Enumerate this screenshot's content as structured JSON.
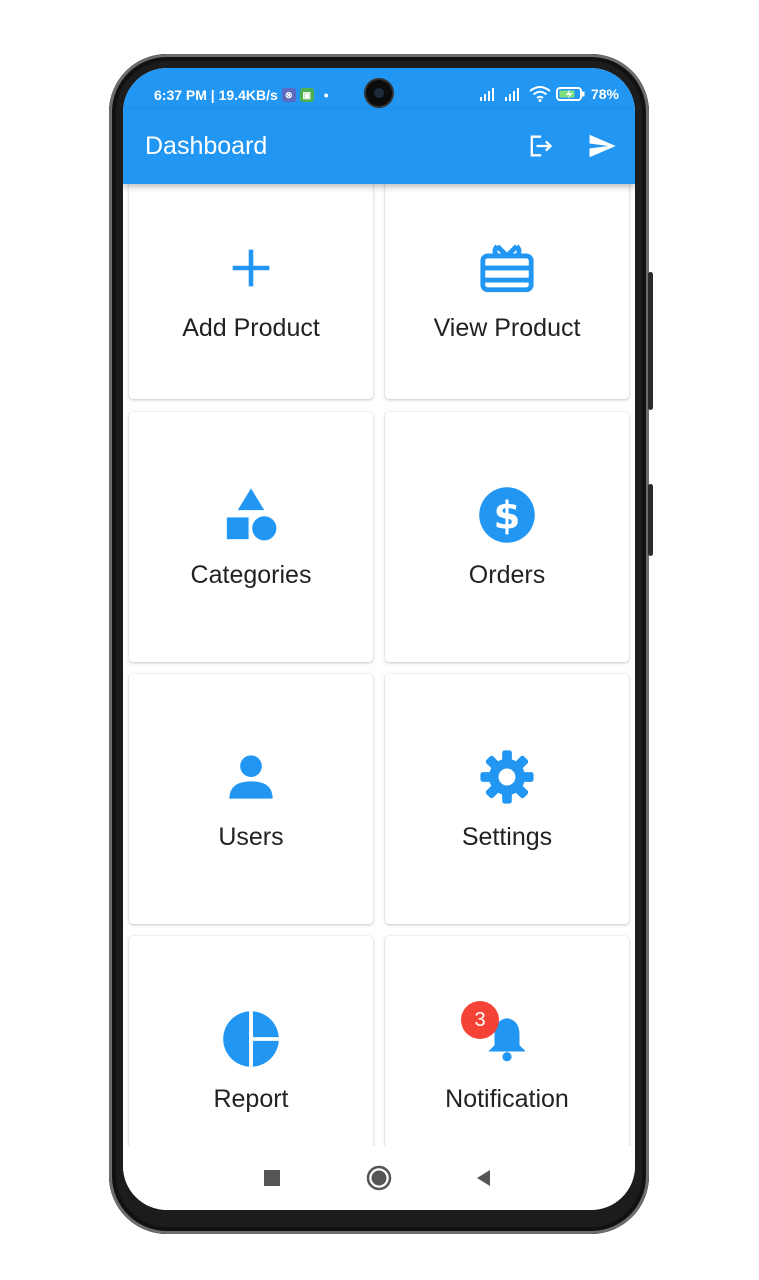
{
  "status_bar": {
    "time_and_speed": "6:37 PM | 19.4KB/s",
    "dot": "•",
    "battery": "78%"
  },
  "app_bar": {
    "title": "Dashboard",
    "accent_color": "#2196f3"
  },
  "cards": [
    {
      "label": "Add Product",
      "icon": "add-icon"
    },
    {
      "label": "View Product",
      "icon": "gift-card-icon"
    },
    {
      "label": "Categories",
      "icon": "category-shapes-icon"
    },
    {
      "label": "Orders",
      "icon": "dollar-circle-icon"
    },
    {
      "label": "Users",
      "icon": "person-icon"
    },
    {
      "label": "Settings",
      "icon": "gear-icon"
    },
    {
      "label": "Report",
      "icon": "pie-chart-icon"
    },
    {
      "label": "Notification",
      "icon": "bell-icon",
      "badge": "3"
    }
  ],
  "nav_bar": {
    "buttons": [
      "recents-square-icon",
      "home-circle-icon",
      "back-triangle-icon"
    ]
  },
  "colors": {
    "badge": "#f44336",
    "icon": "#2196f3"
  }
}
